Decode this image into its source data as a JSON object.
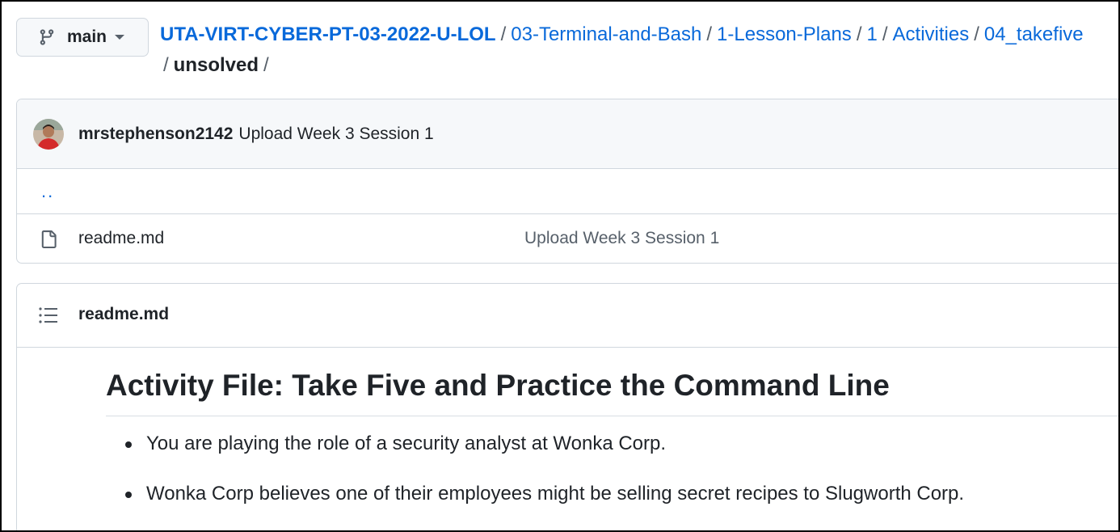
{
  "branch": {
    "label": "main",
    "icon": "git-branch-icon"
  },
  "breadcrumb": {
    "repo": "UTA-VIRT-CYBER-PT-03-2022-U-LOL",
    "separator": "/",
    "parts": [
      "03-Terminal-and-Bash",
      "1-Lesson-Plans",
      "1",
      "Activities",
      "04_takefive"
    ],
    "current": "unsolved",
    "trailing": "/"
  },
  "commit": {
    "author": "mrstephenson2142",
    "message": "Upload Week 3 Session 1"
  },
  "files": {
    "parent_link": "..",
    "rows": [
      {
        "name": "readme.md",
        "commit_message": "Upload Week 3 Session 1",
        "icon": "file-icon"
      }
    ]
  },
  "readme": {
    "filename": "readme.md",
    "heading": "Activity File: Take Five and Practice the Command Line",
    "bullets": [
      "You are playing the role of a security analyst at Wonka Corp.",
      "Wonka Corp believes one of their employees might be selling secret recipes to Slugworth Corp."
    ]
  },
  "colors": {
    "link": "#0969da",
    "text": "#1f2328",
    "muted": "#57606a",
    "border": "#d0d7de",
    "header_bg": "#f6f8fa"
  }
}
